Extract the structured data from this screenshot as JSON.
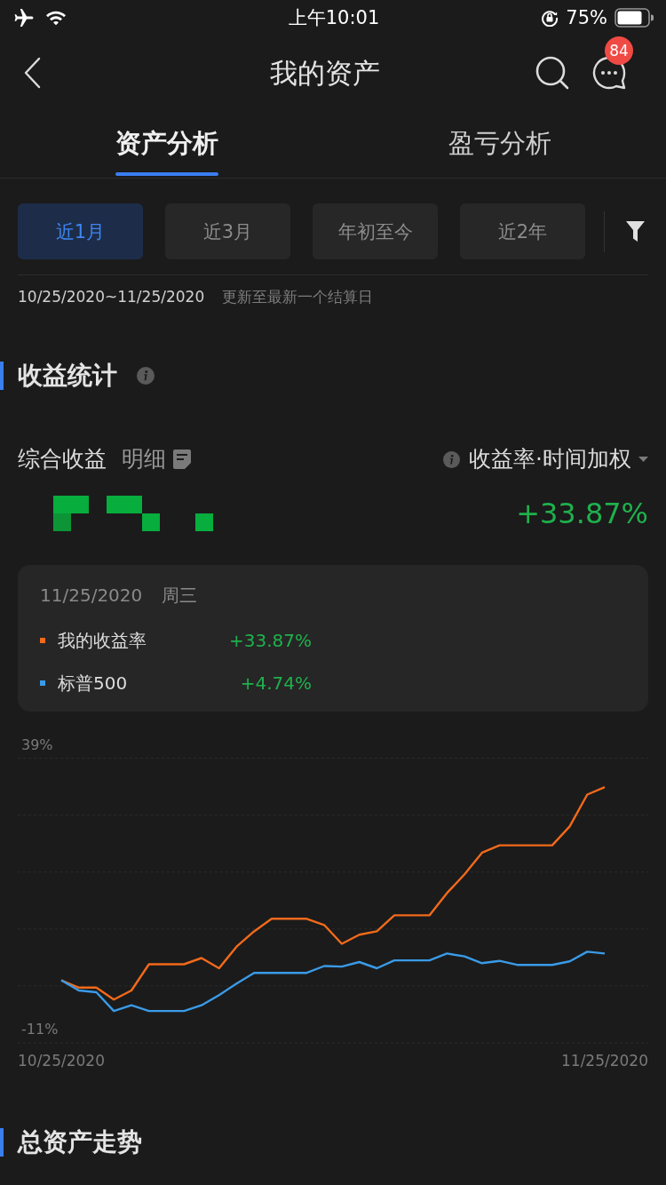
{
  "status_bar": {
    "time": "上午10:01",
    "battery": "75%"
  },
  "header": {
    "title": "我的资产",
    "badge": "84"
  },
  "tabs": [
    {
      "label": "资产分析",
      "selected": true
    },
    {
      "label": "盈亏分析",
      "selected": false
    }
  ],
  "periods": [
    {
      "label": "近1月",
      "selected": true
    },
    {
      "label": "近3月",
      "selected": false
    },
    {
      "label": "年初至今",
      "selected": false
    },
    {
      "label": "近2年",
      "selected": false
    }
  ],
  "date_range": {
    "range": "10/25/2020~11/25/2020",
    "note": "更新至最新一个结算日"
  },
  "income_section": {
    "title": "收益统计",
    "label": "综合收益",
    "detail_link": "明细",
    "metric_selector": "收益率·时间加权",
    "return_value": "+33.87%",
    "tooltip": {
      "date": "11/25/2020",
      "weekday": "周三",
      "rows": [
        {
          "label": "我的收益率",
          "value": "+33.87%",
          "color": "#f26a1b"
        },
        {
          "label": "标普500",
          "value": "+4.74%",
          "color": "#3a9be8"
        }
      ]
    },
    "chart_data": {
      "type": "line",
      "categories": [
        "10/25/2020",
        null,
        null,
        null,
        null,
        null,
        null,
        null,
        null,
        null,
        null,
        null,
        null,
        null,
        null,
        null,
        null,
        null,
        null,
        null,
        null,
        null,
        null,
        null,
        null,
        null,
        null,
        null,
        null,
        null,
        null,
        "11/25/2020"
      ],
      "ylim": [
        -11,
        39
      ],
      "yticks": [
        {
          "value": 39,
          "label": "39%"
        },
        {
          "value": -11,
          "label": "-11%"
        }
      ],
      "series": [
        {
          "color": "#f26a1b",
          "values": [
            0,
            -1.3,
            -1.3,
            -3.4,
            -1.8,
            2.8,
            2.8,
            2.8,
            3.9,
            2.1,
            5.9,
            8.6,
            10.8,
            10.8,
            10.8,
            9.7,
            6.4,
            8.0,
            8.6,
            11.4,
            11.4,
            11.4,
            15.3,
            18.6,
            22.4,
            23.7,
            23.7,
            23.7,
            23.7,
            27.0,
            32.6,
            33.9
          ]
        },
        {
          "color": "#3a9be8",
          "values": [
            0,
            -1.8,
            -2.1,
            -5.4,
            -4.4,
            -5.4,
            -5.4,
            -5.4,
            -4.4,
            -2.6,
            -0.6,
            1.3,
            1.3,
            1.3,
            1.3,
            2.5,
            2.4,
            3.2,
            2.1,
            3.5,
            3.5,
            3.5,
            4.7,
            4.2,
            3.0,
            3.4,
            2.7,
            2.7,
            2.7,
            3.3,
            5.0,
            4.7
          ]
        }
      ]
    }
  },
  "asset_trend_section": {
    "title": "总资产走势"
  }
}
